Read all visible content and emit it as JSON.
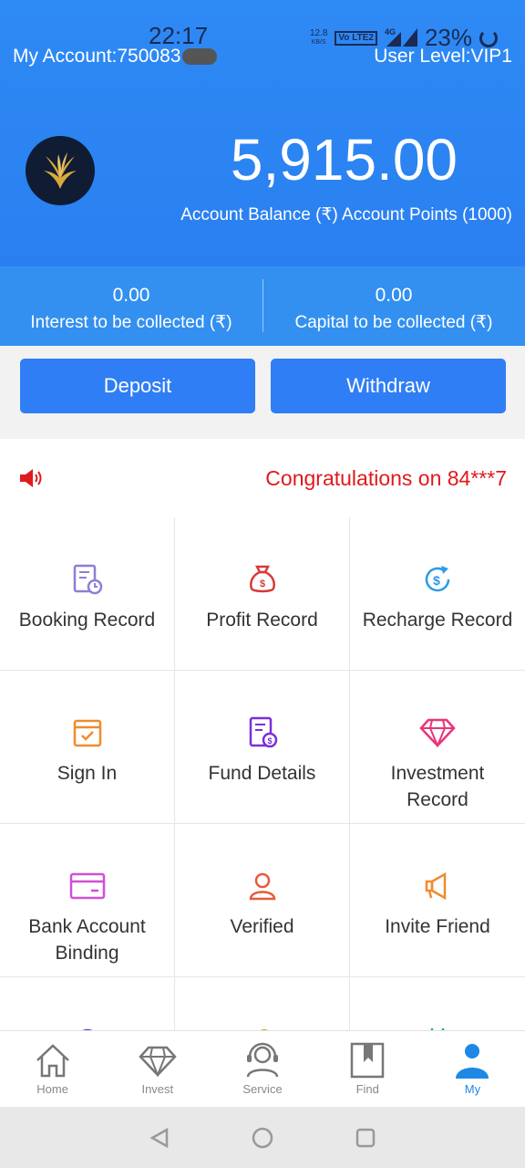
{
  "status_bar": {
    "time": "22:17",
    "net_speed": "12.8",
    "net_unit": "KB/S",
    "volte": "Vo LTE2",
    "signal": "4G",
    "battery": "23%"
  },
  "header": {
    "account_label": "My Account:750083",
    "user_level": "User Level:VIP1",
    "balance": "5,915.00",
    "balance_label": "Account Balance (₹) Account Points (1000)"
  },
  "collect": [
    {
      "value": "0.00",
      "label": "Interest to be collected (₹)"
    },
    {
      "value": "0.00",
      "label": "Capital to be collected (₹)"
    }
  ],
  "buttons": {
    "deposit": "Deposit",
    "withdraw": "Withdraw"
  },
  "notice": {
    "text": "Congratulations on 84***7"
  },
  "grid": [
    {
      "label": "Booking Record",
      "icon": "booking-record-icon",
      "color": "#8b7fd6"
    },
    {
      "label": "Profit Record",
      "icon": "money-bag-icon",
      "color": "#d83a3a"
    },
    {
      "label": "Recharge Record",
      "icon": "recharge-icon",
      "color": "#2b9be8"
    },
    {
      "label": "Sign In",
      "icon": "calendar-check-icon",
      "color": "#f08c2c"
    },
    {
      "label": "Fund Details",
      "icon": "fund-details-icon",
      "color": "#7b2fd8"
    },
    {
      "label": "Investment Record",
      "icon": "diamond-icon",
      "color": "#e8357a"
    },
    {
      "label": "Bank Account Binding",
      "icon": "bank-card-icon",
      "color": "#d04fd8"
    },
    {
      "label": "Verified",
      "icon": "user-verified-icon",
      "color": "#e85a3a"
    },
    {
      "label": "Invite Friend",
      "icon": "megaphone-icon",
      "color": "#f08c2c"
    }
  ],
  "bottom_nav": [
    {
      "label": "Home",
      "icon": "home-icon"
    },
    {
      "label": "Invest",
      "icon": "diamond-icon"
    },
    {
      "label": "Service",
      "icon": "headset-icon"
    },
    {
      "label": "Find",
      "icon": "bookmark-icon"
    },
    {
      "label": "My",
      "icon": "user-icon",
      "active": true
    }
  ],
  "colors": {
    "header_blue": "#2a7ff0",
    "button_blue": "#2f7ef5",
    "notice_red": "#e0191d",
    "active_nav": "#1e88e5"
  }
}
